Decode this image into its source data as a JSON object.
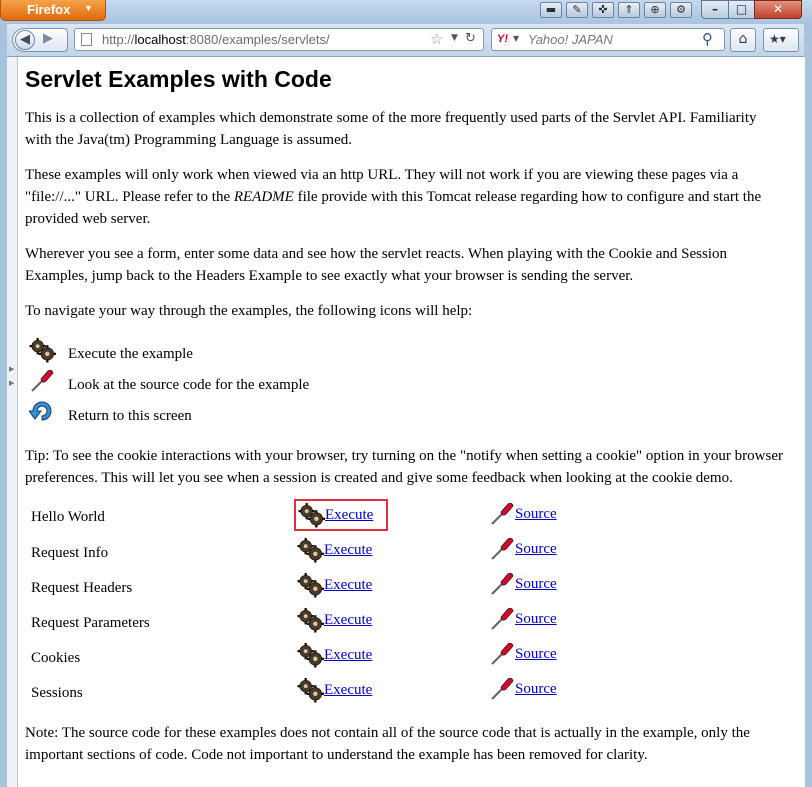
{
  "browser": {
    "app_button": "Firefox",
    "url": {
      "prefix": "http://",
      "host": "localhost",
      "rest": ":8080/examples/servlets/"
    },
    "search_placeholder": "Yahoo! JAPAN",
    "search_engine": "Y!"
  },
  "page": {
    "title": "Servlet Examples with Code",
    "intro": "This is a collection of examples which demonstrate some of the more frequently used parts of the Servlet API. Familiarity with the Java(tm) Programming Language is assumed.",
    "http_note_before": "These examples will only work when viewed via an http URL. They will not work if you are viewing these pages via a \"file://...\" URL. Please refer to the ",
    "http_note_readme": "README",
    "http_note_after": " file provide with this Tomcat release regarding how to configure and start the provided web server.",
    "forms_note": "Wherever you see a form, enter some data and see how the servlet reacts. When playing with the Cookie and Session Examples, jump back to the Headers Example to see exactly what your browser is sending the server.",
    "navigate_note": "To navigate your way through the examples, the following icons will help:",
    "legend": [
      {
        "icon": "execute-icon",
        "text": "Execute the example"
      },
      {
        "icon": "source-icon",
        "text": "Look at the source code for the example"
      },
      {
        "icon": "return-icon",
        "text": "Return to this screen"
      }
    ],
    "tip": "Tip: To see the cookie interactions with your browser, try turning on the \"notify when setting a cookie\" option in your browser preferences. This will let you see when a session is created and give some feedback when looking at the cookie demo.",
    "examples": [
      {
        "name": "Hello World",
        "execute": "Execute",
        "source": "Source"
      },
      {
        "name": "Request Info",
        "execute": "Execute",
        "source": "Source"
      },
      {
        "name": "Request Headers",
        "execute": "Execute",
        "source": "Source"
      },
      {
        "name": "Request Parameters",
        "execute": "Execute",
        "source": "Source"
      },
      {
        "name": "Cookies",
        "execute": "Execute",
        "source": "Source"
      },
      {
        "name": "Sessions",
        "execute": "Execute",
        "source": "Source"
      }
    ],
    "highlighted_example_index": 0,
    "highlight_color": "#e0303a",
    "link_color": "#0000cc",
    "footer_note": "Note: The source code for these examples does not contain all of the source code that is actually in the example, only the important sections of code. Code not important to understand the example has been removed for clarity."
  }
}
